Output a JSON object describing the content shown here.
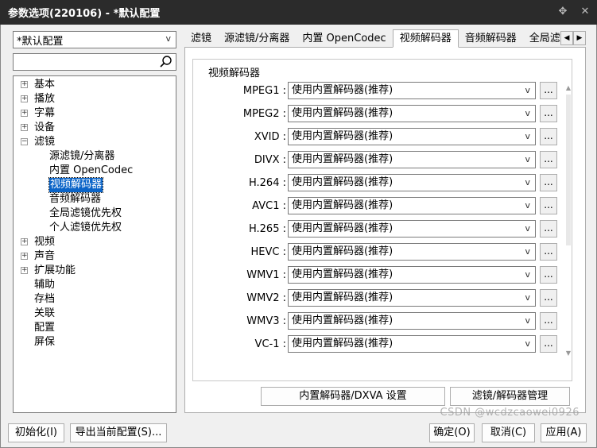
{
  "window": {
    "title": "参数选项(220106) - *默认配置",
    "pin_glyph": "✥",
    "close_glyph": "✕"
  },
  "sidebar": {
    "profile": "*默认配置",
    "search_placeholder": "",
    "tree": [
      {
        "label": "基本",
        "expandable": true,
        "level": 0
      },
      {
        "label": "播放",
        "expandable": true,
        "level": 0
      },
      {
        "label": "字幕",
        "expandable": true,
        "level": 0
      },
      {
        "label": "设备",
        "expandable": true,
        "level": 0
      },
      {
        "label": "滤镜",
        "expandable": true,
        "expanded": true,
        "level": 0
      },
      {
        "label": "源滤镜/分离器",
        "expandable": false,
        "level": 1
      },
      {
        "label": "内置 OpenCodec",
        "expandable": false,
        "level": 1
      },
      {
        "label": "视频解码器",
        "expandable": false,
        "level": 1,
        "selected": true
      },
      {
        "label": "音频解码器",
        "expandable": false,
        "level": 1
      },
      {
        "label": "全局滤镜优先权",
        "expandable": false,
        "level": 1
      },
      {
        "label": "个人滤镜优先权",
        "expandable": false,
        "level": 1
      },
      {
        "label": "视频",
        "expandable": true,
        "level": 0
      },
      {
        "label": "声音",
        "expandable": true,
        "level": 0
      },
      {
        "label": "扩展功能",
        "expandable": true,
        "level": 0
      },
      {
        "label": "辅助",
        "expandable": false,
        "level": 0
      },
      {
        "label": "存档",
        "expandable": false,
        "level": 0
      },
      {
        "label": "关联",
        "expandable": false,
        "level": 0
      },
      {
        "label": "配置",
        "expandable": false,
        "level": 0
      },
      {
        "label": "屏保",
        "expandable": false,
        "level": 0
      }
    ]
  },
  "tabs": [
    {
      "label": "滤镜",
      "active": false
    },
    {
      "label": "源滤镜/分离器",
      "active": false
    },
    {
      "label": "内置 OpenCodec",
      "active": false
    },
    {
      "label": "视频解码器",
      "active": true
    },
    {
      "label": "音频解码器",
      "active": false
    },
    {
      "label": "全局滤",
      "active": false
    }
  ],
  "group": {
    "title": "视频解码器",
    "rows": [
      {
        "label": "MPEG1 :",
        "value": "使用内置解码器(推荐)"
      },
      {
        "label": "MPEG2 :",
        "value": "使用内置解码器(推荐)"
      },
      {
        "label": "XVID :",
        "value": "使用内置解码器(推荐)"
      },
      {
        "label": "DIVX :",
        "value": "使用内置解码器(推荐)"
      },
      {
        "label": "H.264 :",
        "value": "使用内置解码器(推荐)"
      },
      {
        "label": "AVC1 :",
        "value": "使用内置解码器(推荐)"
      },
      {
        "label": "H.265 :",
        "value": "使用内置解码器(推荐)"
      },
      {
        "label": "HEVC :",
        "value": "使用内置解码器(推荐)"
      },
      {
        "label": "WMV1 :",
        "value": "使用内置解码器(推荐)"
      },
      {
        "label": "WMV2 :",
        "value": "使用内置解码器(推荐)"
      },
      {
        "label": "WMV3 :",
        "value": "使用内置解码器(推荐)"
      },
      {
        "label": "VC-1 :",
        "value": "使用内置解码器(推荐)"
      }
    ],
    "dots_label": "...",
    "btn_builtin": "内置解码器/DXVA 设置",
    "btn_manage": "滤镜/解码器管理"
  },
  "footer": {
    "init": "初始化(I)",
    "export": "导出当前配置(S)...",
    "ok": "确定(O)",
    "cancel": "取消(C)",
    "apply": "应用(A)",
    "watermark": "CSDN @wcdzcaowei0926"
  },
  "colors": {
    "titlebar": "#2b2b2b",
    "selection": "#0a64c8"
  }
}
